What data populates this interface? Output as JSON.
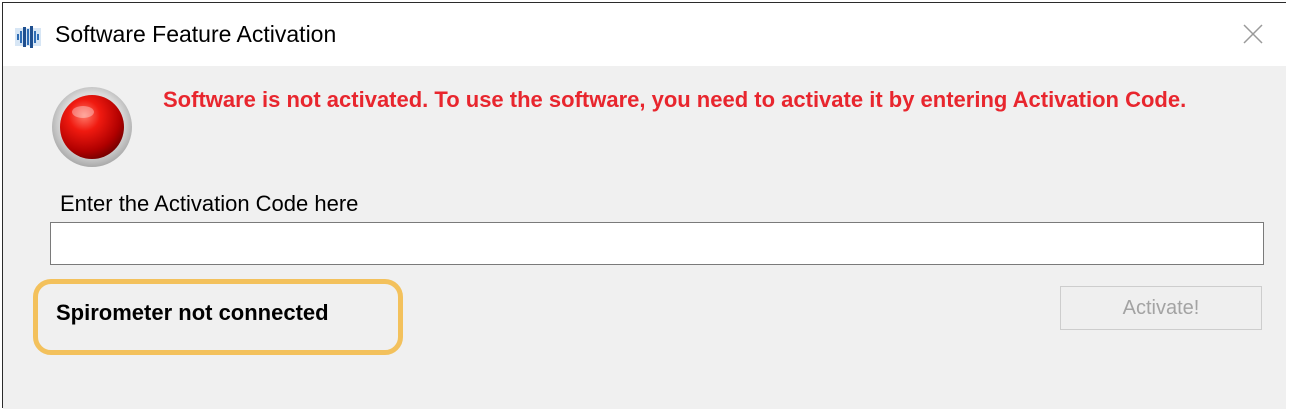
{
  "window": {
    "title": "Software Feature Activation",
    "icon": "app-waveform-icon",
    "close_icon": "close-icon"
  },
  "status": {
    "indicator": "red-status-led-icon",
    "indicator_color": "#e00000",
    "message": "Software is not activated. To use the software, you need to activate it by entering Activation Code.",
    "message_color": "#e8262e"
  },
  "activation": {
    "label": "Enter the Activation Code here",
    "input_value": "",
    "button_label": "Activate!",
    "button_enabled": false
  },
  "device": {
    "status_text": "Spirometer not connected",
    "highlight_color": "#f3c15c"
  }
}
